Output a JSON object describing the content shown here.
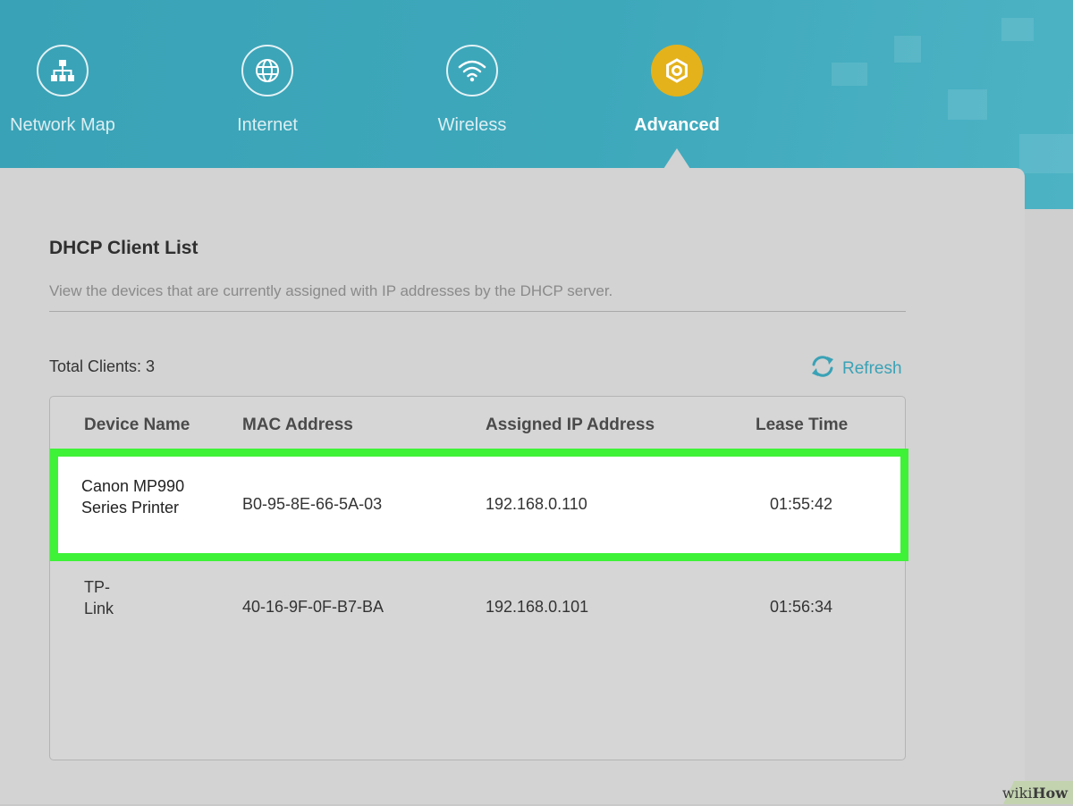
{
  "nav": {
    "items": [
      {
        "label": "Network Map",
        "icon": "network-map-icon",
        "active": false
      },
      {
        "label": "Internet",
        "icon": "globe-icon",
        "active": false
      },
      {
        "label": "Wireless",
        "icon": "wifi-icon",
        "active": false
      },
      {
        "label": "Advanced",
        "icon": "gear-icon",
        "active": true
      }
    ]
  },
  "section": {
    "title": "DHCP Client List",
    "description": "View the devices that are currently assigned with IP addresses by the DHCP server."
  },
  "toolbar": {
    "total_clients": "Total Clients: 3",
    "refresh_label": "Refresh",
    "refresh_icon": "refresh-icon"
  },
  "table": {
    "columns": [
      "Device Name",
      "MAC Address",
      "Assigned IP Address",
      "Lease Time"
    ],
    "rows": [
      {
        "device_line1": "Canon MP990",
        "device_line2": "Series Printer",
        "mac": "B0-95-8E-66-5A-03",
        "ip": "192.168.0.110",
        "lease": "01:55:42",
        "highlighted": true
      },
      {
        "device_line1": "TP-",
        "device_line2": "Link",
        "mac": "40-16-9F-0F-B7-BA",
        "ip": "192.168.0.101",
        "lease": "01:56:34",
        "highlighted": false
      }
    ]
  },
  "colors": {
    "header_bg": "#3ea8bb",
    "active_accent": "#e4b21b",
    "highlight_border": "#3ef238",
    "link": "#3aa2b6"
  },
  "watermark": {
    "prefix": "wiki",
    "suffix": "How"
  }
}
